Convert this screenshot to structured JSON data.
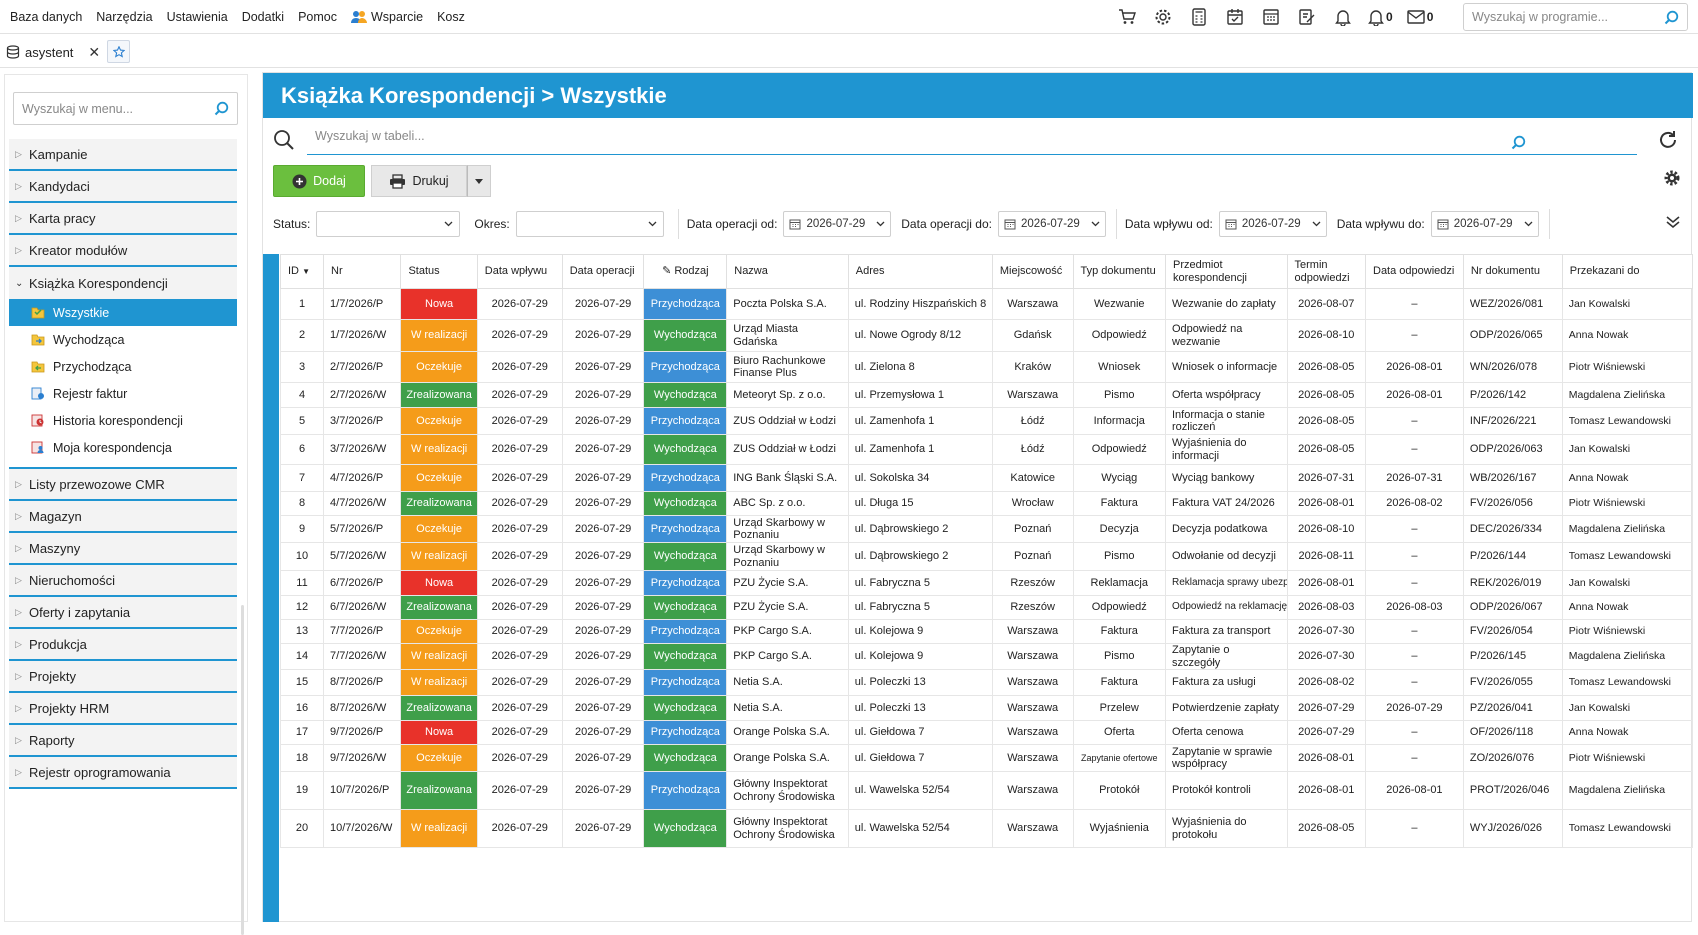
{
  "menubar": {
    "items": [
      "Baza danych",
      "Narzędzia",
      "Ustawienia",
      "Dodatki",
      "Pomoc",
      "Wsparcie",
      "Kosz"
    ],
    "bell_count": "0",
    "mail_count": "0",
    "search_placeholder": "Wyszukaj w programie..."
  },
  "tab": {
    "label": "asystent"
  },
  "sidebar": {
    "search_placeholder": "Wyszukaj w menu...",
    "items_top": [
      "Kampanie",
      "Kandydaci",
      "Karta pracy",
      "Kreator modułów"
    ],
    "open_item": "Książka Korespondencji",
    "sub_items": [
      "Wszystkie",
      "Wychodząca",
      "Przychodząca",
      "Rejestr faktur",
      "Historia korespondencji",
      "Moja korespondencja"
    ],
    "items_bottom": [
      "Listy przewozowe CMR",
      "Magazyn",
      "Maszyny",
      "Nieruchomości",
      "Oferty i zapytania",
      "Produkcja",
      "Projekty",
      "Projekty HRM",
      "Raporty",
      "Rejestr oprogramowania"
    ]
  },
  "main": {
    "title": "Książka Korespondencji > Wszystkie",
    "table_search_placeholder": "Wyszukaj w tabeli...",
    "add_label": "Dodaj",
    "print_label": "Drukuj"
  },
  "filters": {
    "status_label": "Status:",
    "period_label": "Okres:",
    "op_from_label": "Data operacji od:",
    "op_from": "2026-07-29",
    "op_to_label": "Data operacji do:",
    "op_to": "2026-07-29",
    "in_from_label": "Data wpływu od:",
    "in_from": "2026-07-29",
    "in_to_label": "Data wpływu do:",
    "in_to": "2026-07-29"
  },
  "table": {
    "columns": [
      "ID",
      "Nr",
      "Status",
      "Data wpływu",
      "Data operacji",
      "Rodzaj",
      "Nazwa",
      "Adres",
      "Miejscowość",
      "Typ dokumentu",
      "Przedmiot korespondencji",
      "Termin odpowiedzi",
      "Data odpowiedzi",
      "Nr dokumentu",
      "Przekazani do"
    ],
    "rows": [
      [
        "1",
        "1/7/2026/P",
        "Nowa",
        "2026-07-29",
        "2026-07-29",
        "Przychodząca",
        "Poczta Polska S.A.",
        "ul. Rodziny Hiszpańskich 8",
        "Warszawa",
        "Wezwanie",
        "Wezwanie do zapłaty",
        "2026-08-07",
        "–",
        "WEZ/2026/081",
        "Jan Kowalski"
      ],
      [
        "2",
        "1/7/2026/W",
        "W realizacji",
        "2026-07-29",
        "2026-07-29",
        "Wychodząca",
        "Urząd Miasta Gdańska",
        "ul. Nowe Ogrody 8/12",
        "Gdańsk",
        "Odpowiedź",
        "Odpowiedź na wezwanie",
        "2026-08-10",
        "–",
        "ODP/2026/065",
        "Anna Nowak"
      ],
      [
        "3",
        "2/7/2026/P",
        "Oczekuje",
        "2026-07-29",
        "2026-07-29",
        "Przychodząca",
        "Biuro Rachunkowe Finanse Plus",
        "ul. Zielona 8",
        "Kraków",
        "Wniosek",
        "Wniosek o informacje",
        "2026-08-05",
        "2026-08-01",
        "WN/2026/078",
        "Piotr Wiśniewski"
      ],
      [
        "4",
        "2/7/2026/W",
        "Zrealizowana",
        "2026-07-29",
        "2026-07-29",
        "Wychodząca",
        "Meteoryt Sp. z o.o.",
        "ul. Przemysłowa 1",
        "Warszawa",
        "Pismo",
        "Oferta współpracy",
        "2026-08-05",
        "2026-08-01",
        "P/2026/142",
        "Magdalena Zielińska"
      ],
      [
        "5",
        "3/7/2026/P",
        "Oczekuje",
        "2026-07-29",
        "2026-07-29",
        "Przychodząca",
        "ZUS Oddział w Łodzi",
        "ul. Zamenhofa 1",
        "Łódź",
        "Informacja",
        "Informacja o stanie rozliczeń",
        "2026-08-05",
        "–",
        "INF/2026/221",
        "Tomasz Lewandowski"
      ],
      [
        "6",
        "3/7/2026/W",
        "W realizacji",
        "2026-07-29",
        "2026-07-29",
        "Wychodząca",
        "ZUS Oddział w Łodzi",
        "ul. Zamenhofa 1",
        "Łódź",
        "Odpowiedź",
        "Wyjaśnienia do informacji",
        "2026-08-05",
        "–",
        "ODP/2026/063",
        "Jan Kowalski"
      ],
      [
        "7",
        "4/7/2026/P",
        "Oczekuje",
        "2026-07-29",
        "2026-07-29",
        "Przychodząca",
        "ING Bank Śląski S.A.",
        "ul. Sokolska 34",
        "Katowice",
        "Wyciąg",
        "Wyciąg bankowy",
        "2026-07-31",
        "2026-07-31",
        "WB/2026/167",
        "Anna Nowak"
      ],
      [
        "8",
        "4/7/2026/W",
        "Zrealizowana",
        "2026-07-29",
        "2026-07-29",
        "Wychodząca",
        "ABC Sp. z o.o.",
        "ul. Długa 15",
        "Wrocław",
        "Faktura",
        "Faktura VAT 24/2026",
        "2026-08-01",
        "2026-08-02",
        "FV/2026/056",
        "Piotr Wiśniewski"
      ],
      [
        "9",
        "5/7/2026/P",
        "Oczekuje",
        "2026-07-29",
        "2026-07-29",
        "Przychodząca",
        "Urząd Skarbowy w Poznaniu",
        "ul. Dąbrowskiego 2",
        "Poznań",
        "Decyzja",
        "Decyzja podatkowa",
        "2026-08-10",
        "–",
        "DEC/2026/334",
        "Magdalena Zielińska"
      ],
      [
        "10",
        "5/7/2026/W",
        "W realizacji",
        "2026-07-29",
        "2026-07-29",
        "Wychodząca",
        "Urząd Skarbowy w Poznaniu",
        "ul. Dąbrowskiego 2",
        "Poznań",
        "Pismo",
        "Odwołanie od decyzji",
        "2026-08-11",
        "–",
        "P/2026/144",
        "Tomasz Lewandowski"
      ],
      [
        "11",
        "6/7/2026/P",
        "Nowa",
        "2026-07-29",
        "2026-07-29",
        "Przychodząca",
        "PZU Życie S.A.",
        "ul. Fabryczna 5",
        "Rzeszów",
        "Reklamacja",
        "Reklamacja sprawy ubezp.",
        "2026-08-01",
        "–",
        "REK/2026/019",
        "Jan Kowalski"
      ],
      [
        "12",
        "6/7/2026/W",
        "Zrealizowana",
        "2026-07-29",
        "2026-07-29",
        "Wychodząca",
        "PZU Życie S.A.",
        "ul. Fabryczna 5",
        "Rzeszów",
        "Odpowiedź",
        "Odpowiedź na reklamację",
        "2026-08-03",
        "2026-08-03",
        "ODP/2026/067",
        "Anna Nowak"
      ],
      [
        "13",
        "7/7/2026/P",
        "Oczekuje",
        "2026-07-29",
        "2026-07-29",
        "Przychodząca",
        "PKP Cargo S.A.",
        "ul. Kolejowa 9",
        "Warszawa",
        "Faktura",
        "Faktura za transport",
        "2026-07-30",
        "–",
        "FV/2026/054",
        "Piotr Wiśniewski"
      ],
      [
        "14",
        "7/7/2026/W",
        "W realizacji",
        "2026-07-29",
        "2026-07-29",
        "Wychodząca",
        "PKP Cargo S.A.",
        "ul. Kolejowa 9",
        "Warszawa",
        "Pismo",
        "Zapytanie o szczegóły",
        "2026-07-30",
        "–",
        "P/2026/145",
        "Magdalena Zielińska"
      ],
      [
        "15",
        "8/7/2026/P",
        "W realizacji",
        "2026-07-29",
        "2026-07-29",
        "Przychodząca",
        "Netia S.A.",
        "ul. Poleczki 13",
        "Warszawa",
        "Faktura",
        "Faktura za usługi",
        "2026-08-02",
        "–",
        "FV/2026/055",
        "Tomasz Lewandowski"
      ],
      [
        "16",
        "8/7/2026/W",
        "Zrealizowana",
        "2026-07-29",
        "2026-07-29",
        "Wychodząca",
        "Netia S.A.",
        "ul. Poleczki 13",
        "Warszawa",
        "Przelew",
        "Potwierdzenie zapłaty",
        "2026-07-29",
        "2026-07-29",
        "PZ/2026/041",
        "Jan Kowalski"
      ],
      [
        "17",
        "9/7/2026/P",
        "Nowa",
        "2026-07-29",
        "2026-07-29",
        "Przychodząca",
        "Orange Polska S.A.",
        "ul. Giełdowa 7",
        "Warszawa",
        "Oferta",
        "Oferta cenowa",
        "2026-07-29",
        "–",
        "OF/2026/118",
        "Anna Nowak"
      ],
      [
        "18",
        "9/7/2026/W",
        "Oczekuje",
        "2026-07-29",
        "2026-07-29",
        "Wychodząca",
        "Orange Polska S.A.",
        "ul. Giełdowa 7",
        "Warszawa",
        "Zapytanie ofertowe",
        "Zapytanie w sprawie współpracy",
        "2026-08-01",
        "–",
        "ZO/2026/076",
        "Piotr Wiśniewski"
      ],
      [
        "19",
        "10/7/2026/P",
        "Zrealizowana",
        "2026-07-29",
        "2026-07-29",
        "Przychodząca",
        "Główny Inspektorat Ochrony Środowiska",
        "ul. Wawelska 52/54",
        "Warszawa",
        "Protokół",
        "Protokół kontroli",
        "2026-08-01",
        "2026-08-01",
        "PROT/2026/046",
        "Magdalena Zielińska"
      ],
      [
        "20",
        "10/7/2026/W",
        "W realizacji",
        "2026-07-29",
        "2026-07-29",
        "Wychodząca",
        "Główny Inspektorat Ochrony Środowiska",
        "ul. Wawelska 52/54",
        "Warszawa",
        "Wyjaśnienia",
        "Wyjaśnienia do protokołu",
        "2026-08-05",
        "–",
        "WYJ/2026/026",
        "Tomasz Lewandowski"
      ]
    ]
  },
  "colors": {
    "accent": "#1f95d1",
    "status_new": "#e8322a",
    "status_in_progress": "#f59c1a",
    "status_waiting": "#f59c1a",
    "status_done": "#3f9f4a",
    "kind_in": "#3d8fd6",
    "kind_out": "#3f9f4a"
  }
}
